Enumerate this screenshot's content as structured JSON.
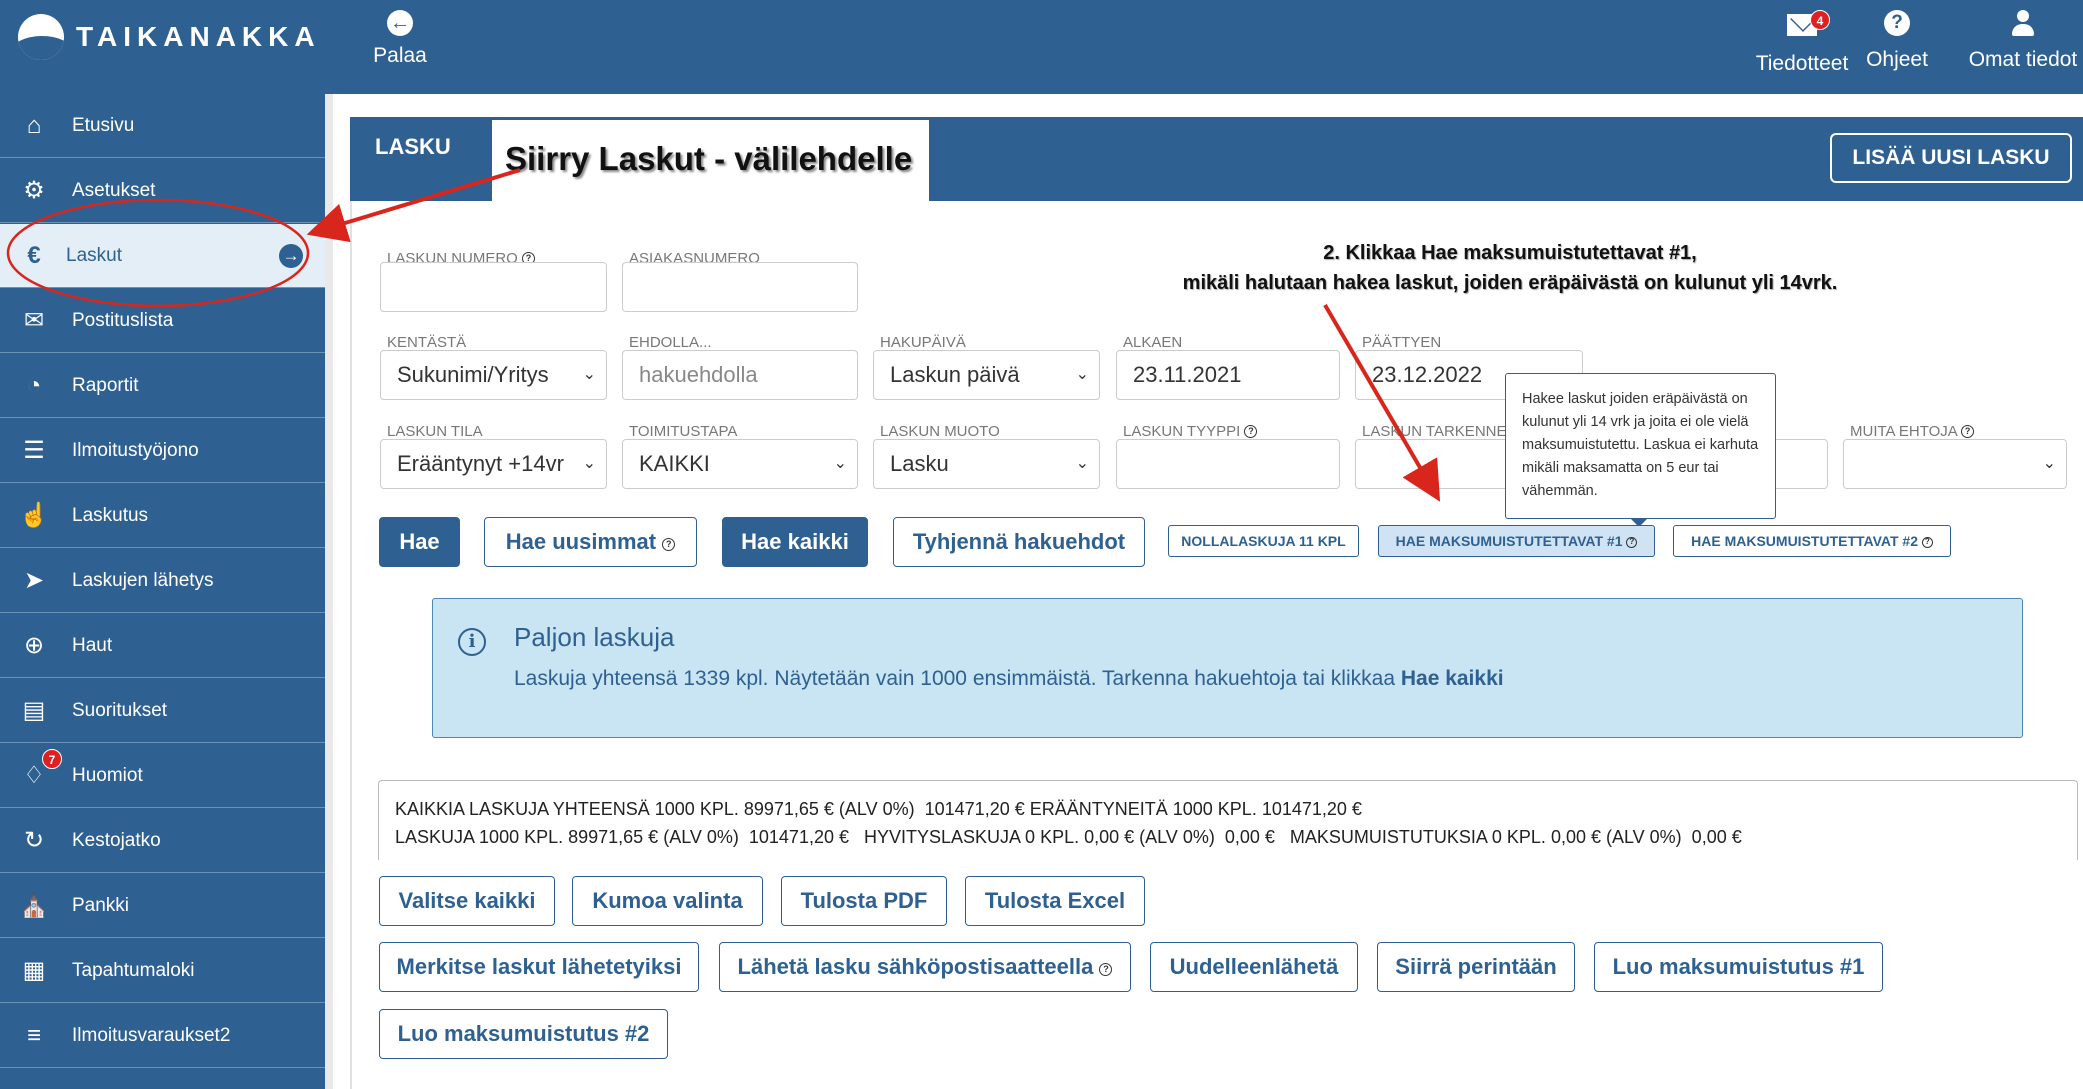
{
  "topbar": {
    "logo_text": "TAIKANAKKA",
    "back_label": "Palaa",
    "notifications_label": "Tiedotteet",
    "notifications_count": "4",
    "help_label": "Ohjeet",
    "account_label": "Omat tiedot"
  },
  "sidebar": {
    "items": [
      {
        "label": "Etusivu",
        "icon": "home-icon"
      },
      {
        "label": "Asetukset",
        "icon": "gear-icon"
      },
      {
        "label": "Laskut",
        "icon": "euro-icon"
      },
      {
        "label": "Postituslista",
        "icon": "envelope-icon"
      },
      {
        "label": "Raportit",
        "icon": "pie-chart-icon"
      },
      {
        "label": "Ilmoitustyöjono",
        "icon": "list-icon"
      },
      {
        "label": "Laskutus",
        "icon": "thumbs-up-icon"
      },
      {
        "label": "Laskujen lähetys",
        "icon": "paper-plane-icon"
      },
      {
        "label": "Haut",
        "icon": "search-plus-icon"
      },
      {
        "label": "Suoritukset",
        "icon": "book-icon"
      },
      {
        "label": "Huomiot",
        "icon": "bell-icon",
        "badge": "7"
      },
      {
        "label": "Kestojatko",
        "icon": "refresh-icon"
      },
      {
        "label": "Pankki",
        "icon": "bank-icon"
      },
      {
        "label": "Tapahtumaloki",
        "icon": "grid-icon"
      },
      {
        "label": "Ilmoitusvaraukset2",
        "icon": "list-alt-icon"
      }
    ]
  },
  "panel": {
    "tab_label": "LASKU",
    "annotation_1": "Siirry Laskut - välilehdelle",
    "add_button": "LISÄÄ UUSI LASKU",
    "annotation_2_line1": "2. Klikkaa Hae maksumuistutettavat #1,",
    "annotation_2_line2": "mikäli halutaan hakea laskut, joiden eräpäivästä on kulunut yli 14vrk."
  },
  "form": {
    "laskun_numero_label": "LASKUN NUMERO",
    "asiakasnumero_label": "ASIAKASNUMERO",
    "kentasta_label": "KENTÄSTÄ",
    "kentasta_value": "Sukunimi/Yritys",
    "ehdolla_label": "EHDOLLA...",
    "ehdolla_placeholder": "hakuehdolla",
    "hakupaiva_label": "HAKUPÄIVÄ",
    "hakupaiva_value": "Laskun päivä",
    "alkaen_label": "ALKAEN",
    "alkaen_value": "23.11.2021",
    "paattyen_label": "PÄÄTTYEN",
    "paattyen_value": "23.12.2022",
    "laskun_tila_label": "LASKUN TILA",
    "laskun_tila_value": "Erääntynyt +14vr",
    "toimitustapa_label": "TOIMITUSTAPA",
    "toimitustapa_value": "KAIKKI",
    "laskun_muoto_label": "LASKUN MUOTO",
    "laskun_muoto_value": "Lasku",
    "laskun_tyyppi_label": "LASKUN TYYPPI",
    "laskun_tarkenne_label": "LASKUN TARKENNE",
    "muita_ehtoja_label": "MUITA EHTOJA"
  },
  "tooltip": {
    "text": "Hakee laskut joiden eräpäivästä on kulunut yli 14 vrk ja joita ei ole vielä maksumuistutettu. Laskua ei karhuta mikäli maksamatta on 5 eur tai vähemmän."
  },
  "search_buttons": {
    "hae": "Hae",
    "hae_uusimmat": "Hae uusimmat",
    "hae_kaikki": "Hae kaikki",
    "tyhjenna": "Tyhjennä hakuehdot",
    "nollalaskuja": "NOLLALASKUJA 11 KPL",
    "maksumuistutettavat_1": "HAE MAKSUMUISTUTETTAVAT #1",
    "maksumuistutettavat_2": "HAE MAKSUMUISTUTETTAVAT #2"
  },
  "info": {
    "title": "Paljon laskuja",
    "text": "Laskuja yhteensä 1339 kpl. Näytetään vain 1000 ensimmäistä. Tarkenna hakuehtoja tai klikkaa ",
    "link": "Hae kaikki"
  },
  "summary": {
    "line1": "KAIKKIA LASKUJA YHTEENSÄ 1000 KPL. 89971,65 € (ALV 0%)  101471,20 € ERÄÄNTYNEITÄ 1000 KPL. 101471,20 €",
    "line2": "LASKUJA 1000 KPL. 89971,65 € (ALV 0%)  101471,20 €   HYVITYSLASKUJA 0 KPL. 0,00 € (ALV 0%)  0,00 €   MAKSUMUISTUTUKSIA 0 KPL. 0,00 € (ALV 0%)  0,00 €"
  },
  "actions": {
    "valitse_kaikki": "Valitse kaikki",
    "kumoa_valinta": "Kumoa valinta",
    "tulosta_pdf": "Tulosta PDF",
    "tulosta_excel": "Tulosta Excel",
    "merkitse": "Merkitse laskut lähetetyiksi",
    "laheta_sahkoposti": "Lähetä lasku sähköpostisaatteella",
    "uudelleenlaheta": "Uudelleenlähetä",
    "siirra_perintaan": "Siirrä perintään",
    "luo_maksumuistutus_1": "Luo maksumuistutus #1",
    "luo_maksumuistutus_2": "Luo maksumuistutus #2"
  },
  "colors": {
    "brand": "#2e6191",
    "annotation_red": "#d9261c",
    "info_bg": "#c9e4f2",
    "badge_red": "#e02020"
  }
}
